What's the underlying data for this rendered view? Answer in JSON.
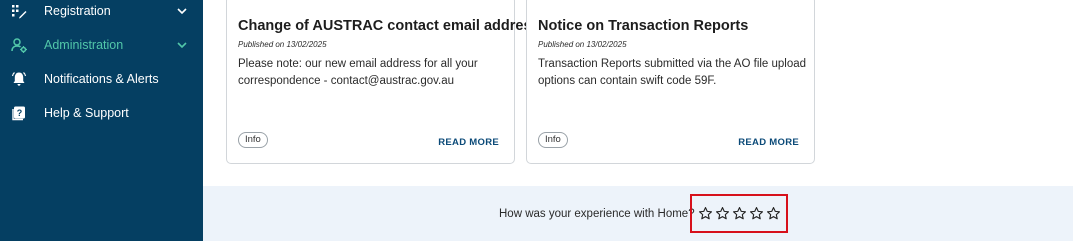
{
  "sidebar": {
    "items": [
      {
        "label": "Registration",
        "icon": "registration-icon",
        "expandable": true
      },
      {
        "label": "Administration",
        "icon": "administration-icon",
        "expandable": true,
        "active": true
      },
      {
        "label": "Notifications & Alerts",
        "icon": "bell-icon",
        "expandable": false
      },
      {
        "label": "Help & Support",
        "icon": "help-icon",
        "expandable": false
      }
    ],
    "colors": {
      "background": "#053f62",
      "text": "#ffffff",
      "active_text": "#52c7a9"
    }
  },
  "cards": [
    {
      "title": "Change of AUSTRAC contact email address",
      "published": "Published on 13/02/2025",
      "body": "Please note: our new email address for all your correspondence - contact@austrac.gov.au",
      "tag": "Info",
      "read_more": "READ MORE"
    },
    {
      "title": "Notice on Transaction Reports",
      "published": "Published on 13/02/2025",
      "body": "Transaction Reports submitted via the AO file upload options can contain swift code 59F.",
      "tag": "Info",
      "read_more": "READ MORE"
    }
  ],
  "feedback": {
    "question": "How was your experience with Home?",
    "rating": 0,
    "max_rating": 5,
    "highlight_color": "#d7101b",
    "background": "#edf3fa"
  }
}
